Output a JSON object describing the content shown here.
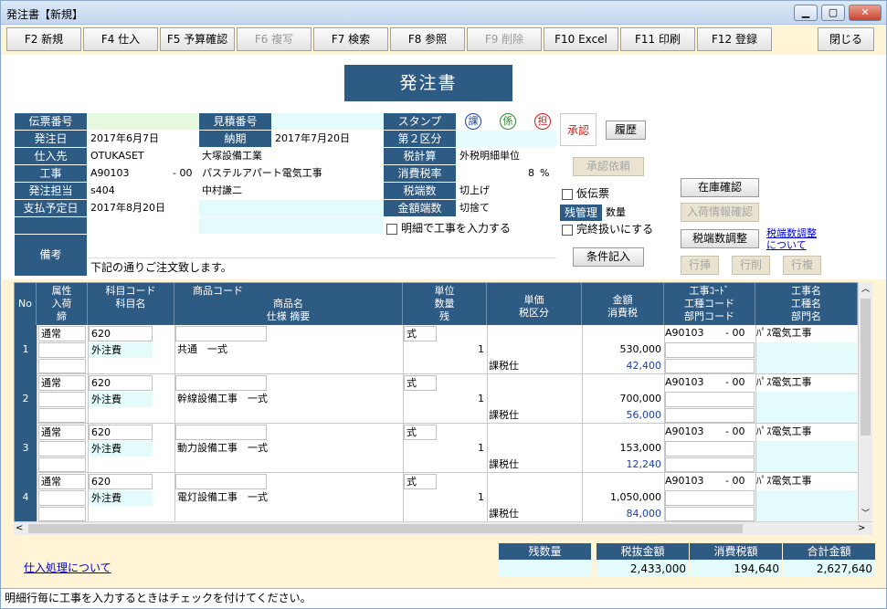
{
  "window": {
    "title": "発注書【新規】",
    "minimize": "▁",
    "maximize": "▢",
    "close": "✕"
  },
  "fkeys": [
    {
      "label": "F2 新規",
      "enabled": true
    },
    {
      "label": "F4 仕入",
      "enabled": true
    },
    {
      "label": "F5 予算確認",
      "enabled": true
    },
    {
      "label": "F6 複写",
      "enabled": false
    },
    {
      "label": "F7 検索",
      "enabled": true
    },
    {
      "label": "F8 参照",
      "enabled": true
    },
    {
      "label": "F9 削除",
      "enabled": false
    },
    {
      "label": "F10 Excel",
      "enabled": true
    },
    {
      "label": "F11 印刷",
      "enabled": true
    },
    {
      "label": "F12 登録",
      "enabled": true
    }
  ],
  "close_button": "閉じる",
  "doc_title": "発注書",
  "header": {
    "denpyo_label": "伝票番号",
    "denpyo_value": "",
    "mitsumori_label": "見積番号",
    "mitsumori_value": "",
    "stamp_label": "スタンプ",
    "stamps": [
      "課",
      "係",
      "担"
    ],
    "hacchubi_label": "発注日",
    "hacchubi_value": "2017年6月7日",
    "nouki_label": "納期",
    "nouki_value": "2017年7月20日",
    "kubun2_label": "第２区分",
    "kubun2_value": "",
    "shiiresaki_label": "仕入先",
    "shiiresaki_code": "OTUKASET",
    "shiiresaki_name": "大塚設備工業",
    "zeikeisan_label": "税計算",
    "zeikeisan_value": "外税明細単位",
    "koji_label": "工事",
    "koji_code": "A90103",
    "koji_sub": "- 00",
    "koji_name": "パステルアパート電気工事",
    "zeiritsu_label": "消費税率",
    "zeiritsu_value": "8",
    "zeiritsu_unit": "%",
    "tanto_label": "発注担当",
    "tanto_code": "s404",
    "tanto_name": "中村謙二",
    "zeihasu_label": "税端数",
    "zeihasu_value": "切上げ",
    "shiharai_label": "支払予定日",
    "shiharai_value": "2017年8月20日",
    "kingakuhasu_label": "金額端数",
    "kingakuhasu_value": "切捨て",
    "zankanri_label": "残管理",
    "zankanri_value": "数量",
    "meisai_koji_check": "明細で工事を入力する",
    "biko_label": "備考",
    "biko_value": "下記の通りご注文致します。"
  },
  "side": {
    "shonin": "承認",
    "rireki": "履歴",
    "shonin_irai": "承認依頼",
    "karidenpyo": "仮伝票",
    "kanryo": "完終扱いにする",
    "joken": "条件記入",
    "zaiko": "在庫確認",
    "nyuka": "入荷情報確認",
    "zeihasu_chosei": "税端数調整",
    "zeihasu_link": "税端数調整\nについて",
    "row_insert": "行挿",
    "row_delete": "行削",
    "row_copy": "行複"
  },
  "grid": {
    "headers": {
      "no": "No",
      "zokusei": "属性\n入荷\n締",
      "kamoku": "科目コード\n科目名",
      "shohin_code": "商品コード",
      "shohin": "商品名\n仕様 摘要",
      "tani": "単位\n数量\n残",
      "tanka": "単価\n税区分",
      "kingaku": "金額\n消費税",
      "kojicode": "工事ｺｰﾄﾞ\n工種コード\n部門コード",
      "kojimei": "工事名\n工種名\n部門名"
    },
    "rows": [
      {
        "no": "1",
        "zokusei": "通常",
        "kamoku_code": "620",
        "kamoku_name": "外注費",
        "shohin": "共通　一式",
        "tani": "式",
        "suryo": "1",
        "zei": "課税仕",
        "kingaku": "530,000",
        "shohizei": "42,400",
        "koji_code": "A90103",
        "koji_sub": "- 00",
        "koji_name": "ﾊﾟｽ電気工事"
      },
      {
        "no": "2",
        "zokusei": "通常",
        "kamoku_code": "620",
        "kamoku_name": "外注費",
        "shohin": "幹線設備工事　一式",
        "tani": "式",
        "suryo": "1",
        "zei": "課税仕",
        "kingaku": "700,000",
        "shohizei": "56,000",
        "koji_code": "A90103",
        "koji_sub": "- 00",
        "koji_name": "ﾊﾟｽ電気工事"
      },
      {
        "no": "3",
        "zokusei": "通常",
        "kamoku_code": "620",
        "kamoku_name": "外注費",
        "shohin": "動力設備工事　一式",
        "tani": "式",
        "suryo": "1",
        "zei": "課税仕",
        "kingaku": "153,000",
        "shohizei": "12,240",
        "koji_code": "A90103",
        "koji_sub": "- 00",
        "koji_name": "ﾊﾟｽ電気工事"
      },
      {
        "no": "4",
        "zokusei": "通常",
        "kamoku_code": "620",
        "kamoku_name": "外注費",
        "shohin": "電灯設備工事　一式",
        "tani": "式",
        "suryo": "1",
        "zei": "課税仕",
        "kingaku": "1,050,000",
        "shohizei": "84,000",
        "koji_code": "A90103",
        "koji_sub": "- 00",
        "koji_name": "ﾊﾟｽ電気工事"
      }
    ]
  },
  "totals": {
    "zansuryo_label": "残数量",
    "zansuryo_value": "",
    "zeinuki_label": "税抜金額",
    "zeinuki_value": "2,433,000",
    "shohizei_label": "消費税額",
    "shohizei_value": "194,640",
    "gokei_label": "合計金額",
    "gokei_value": "2,627,640"
  },
  "shiire_link": "仕入処理について",
  "status": "明細行毎に工事を入力するときはチェックを付けてください。",
  "colors": {
    "header_blue": "#2e5b84",
    "cyan_field": "#e4fbfb",
    "green_field": "#e6f8dd",
    "window_bg": "#fff5d6",
    "link": "#0000cc"
  }
}
